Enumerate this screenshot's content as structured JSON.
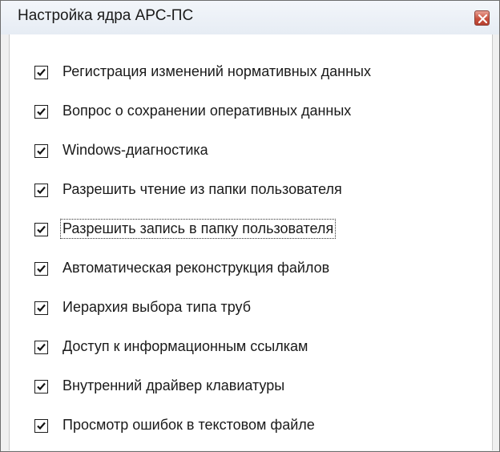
{
  "window": {
    "title": "Настройка ядра АРС-ПС",
    "close_icon": "close-icon"
  },
  "options": [
    {
      "label": "Регистрация изменений нормативных данных",
      "checked": true
    },
    {
      "label": "Вопрос о сохранении оперативных данных",
      "checked": true
    },
    {
      "label": "Windows-диагностика",
      "checked": true
    },
    {
      "label": "Разрешить чтение из папки пользователя",
      "checked": true
    },
    {
      "label": "Разрешить запись в папку пользователя",
      "checked": true,
      "focused": true
    },
    {
      "label": "Автоматическая реконструкция файлов",
      "checked": true
    },
    {
      "label": "Иерархия выбора типа труб",
      "checked": true
    },
    {
      "label": "Доступ к информационным ссылкам",
      "checked": true
    },
    {
      "label": "Внутренний драйвер клавиатуры",
      "checked": true
    },
    {
      "label": "Просмотр ошибок в текстовом файле",
      "checked": true
    }
  ]
}
